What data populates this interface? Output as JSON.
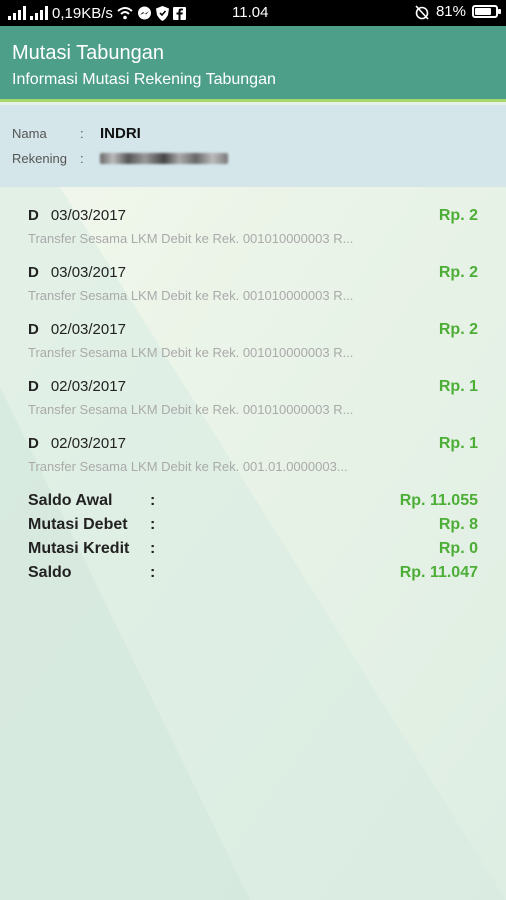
{
  "status_bar": {
    "network_speed": "0,19KB/s",
    "time": "11.04",
    "battery": "81%",
    "battery_level": 0.81
  },
  "header": {
    "title": "Mutasi Tabungan",
    "subtitle": "Informasi Mutasi Rekening Tabungan"
  },
  "account": {
    "name_label": "Nama",
    "name_colon": ":",
    "name_value": "INDRI",
    "rekening_label": "Rekening",
    "rekening_colon": ":"
  },
  "transactions": [
    {
      "type": "D",
      "date": "03/03/2017",
      "amount": "Rp. 2",
      "desc": "Transfer Sesama LKM Debit ke Rek. 001010000003 R..."
    },
    {
      "type": "D",
      "date": "03/03/2017",
      "amount": "Rp. 2",
      "desc": "Transfer Sesama LKM Debit ke Rek. 001010000003 R..."
    },
    {
      "type": "D",
      "date": "02/03/2017",
      "amount": "Rp. 2",
      "desc": "Transfer Sesama LKM Debit ke Rek. 001010000003 R..."
    },
    {
      "type": "D",
      "date": "02/03/2017",
      "amount": "Rp. 1",
      "desc": "Transfer Sesama LKM Debit ke Rek. 001010000003 R..."
    },
    {
      "type": "D",
      "date": "02/03/2017",
      "amount": "Rp. 1",
      "desc": "Transfer Sesama LKM Debit ke Rek. 001.01.0000003..."
    }
  ],
  "summary": [
    {
      "label": "Saldo Awal",
      "colon": ":",
      "value": "Rp. 11.055"
    },
    {
      "label": "Mutasi Debet",
      "colon": ":",
      "value": "Rp. 8"
    },
    {
      "label": "Mutasi Kredit",
      "colon": ":",
      "value": "Rp. 0"
    },
    {
      "label": "Saldo",
      "colon": ":",
      "value": "Rp. 11.047"
    }
  ],
  "colors": {
    "appbar": "#4e9f8a",
    "accent_line": "#a5d86a",
    "amount_green": "#4cae36"
  }
}
